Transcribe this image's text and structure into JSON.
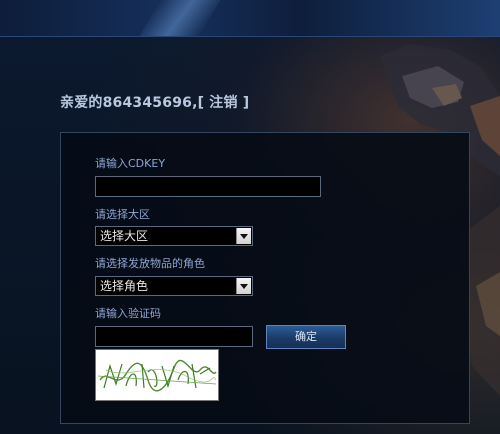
{
  "header": {
    "welcome_prefix": "亲爱的864345696,",
    "logout_label": "[ 注销 ]"
  },
  "form": {
    "cdkey_label": "请输入CDKEY",
    "cdkey_value": "",
    "region_label": "请选择大区",
    "region_selected": "选择大区",
    "role_label": "请选择发放物品的角色",
    "role_selected": "选择角色",
    "captcha_label": "请输入验证码",
    "captcha_value": "",
    "confirm_label": "确定"
  },
  "icons": {
    "select_arrow": "chevron-down-icon",
    "captcha": "captcha-image"
  },
  "colors": {
    "label": "#8da6d4",
    "button": "#1b3b68",
    "background": "#0b1526"
  }
}
